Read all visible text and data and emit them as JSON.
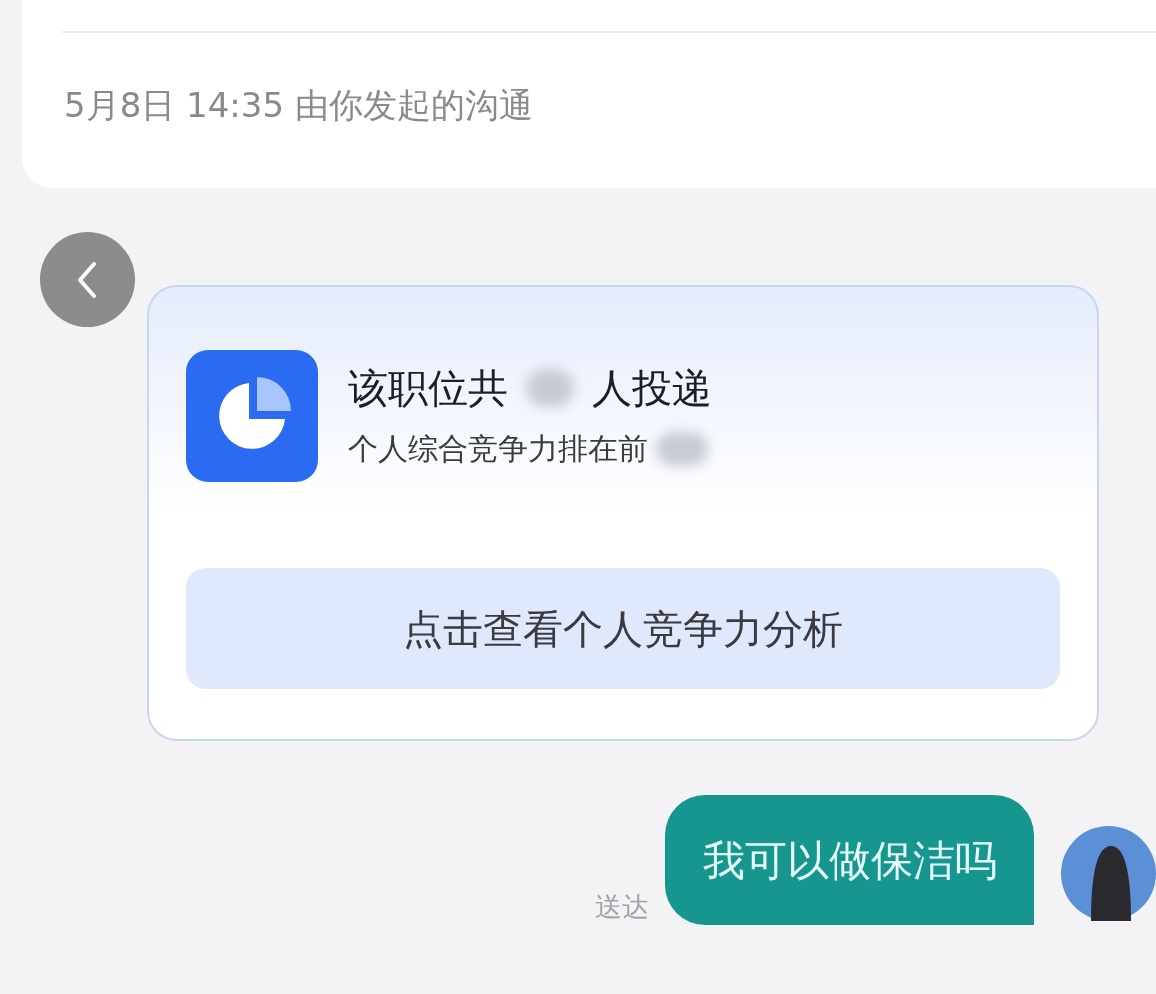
{
  "header_card": {
    "timestamp": "5月8日 14:35 由你发起的沟通"
  },
  "competition_card": {
    "title_before": "该职位共",
    "title_after": "人投递",
    "subtitle": "个人综合竞争力排在前",
    "action": "点击查看个人竞争力分析"
  },
  "messages": [
    {
      "kind": "outgoing",
      "text": "我可以做保洁吗",
      "status": "送达"
    }
  ]
}
